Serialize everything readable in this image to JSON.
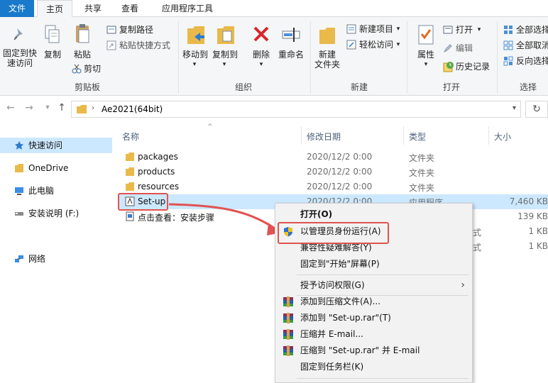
{
  "tabs": {
    "file": "文件",
    "home": "主页",
    "share": "共享",
    "view": "查看",
    "tools": "应用程序工具"
  },
  "ribbon": {
    "pin": "固定到快\n速访问",
    "copy": "复制",
    "paste": "粘贴",
    "copy_path": "复制路径",
    "paste_shortcut": "粘贴快捷方式",
    "cut": "剪切",
    "clipboard_group": "剪贴板",
    "move_to": "移动到",
    "copy_to": "复制到",
    "delete": "删除",
    "rename": "重命名",
    "organize_group": "组织",
    "new_folder": "新建\n文件夹",
    "new_item": "新建项目",
    "easy_access": "轻松访问",
    "new_group": "新建",
    "properties": "属性",
    "open": "打开",
    "edit": "编辑",
    "history": "历史记录",
    "open_group": "打开",
    "select_all": "全部选择",
    "select_none": "全部取消",
    "invert": "反向选择",
    "select_group": "选择"
  },
  "address": {
    "folder": "Ae2021(64bit)"
  },
  "sidebar": {
    "items": [
      {
        "label": "快速访问"
      },
      {
        "label": "OneDrive"
      },
      {
        "label": "此电脑"
      },
      {
        "label": "安装说明 (F:)"
      },
      {
        "label": "网络"
      }
    ]
  },
  "columns": {
    "name": "名称",
    "date": "修改日期",
    "type": "类型",
    "size": "大小"
  },
  "files": [
    {
      "name": "packages",
      "date": "2020/12/2 0:00",
      "type": "文件夹",
      "size": ""
    },
    {
      "name": "products",
      "date": "2020/12/2 0:00",
      "type": "文件夹",
      "size": ""
    },
    {
      "name": "resources",
      "date": "2020/12/2 0:00",
      "type": "文件夹",
      "size": ""
    },
    {
      "name": "Set-up",
      "date": "2020/12/2 0:00",
      "type": "应用程序",
      "size": "7,460 KB"
    },
    {
      "name": "点击查看：安装步骤",
      "date": "",
      "type": "",
      "size": "139 KB"
    },
    {
      "name": "",
      "date": "",
      "type": "式",
      "size": "1 KB"
    },
    {
      "name": "",
      "date": "",
      "type": "式",
      "size": "1 KB"
    }
  ],
  "menu": {
    "open": "打开(O)",
    "run_as_admin": "以管理员身份运行(A)",
    "compat": "兼容性疑难解答(Y)",
    "pin_start": "固定到\"开始\"屏幕(P)",
    "grant_access": "授予访问权限(G)",
    "add_archive": "添加到压缩文件(A)...",
    "add_rar": "添加到 \"Set-up.rar\"(T)",
    "compress_email": "压缩并 E-mail...",
    "compress_rar_email": "压缩到 \"Set-up.rar\" 并 E-mail",
    "pin_taskbar": "固定到任务栏(K)"
  },
  "colors": {
    "accent": "#1979ca",
    "selection": "#cce8ff",
    "annotation": "#e05350"
  }
}
